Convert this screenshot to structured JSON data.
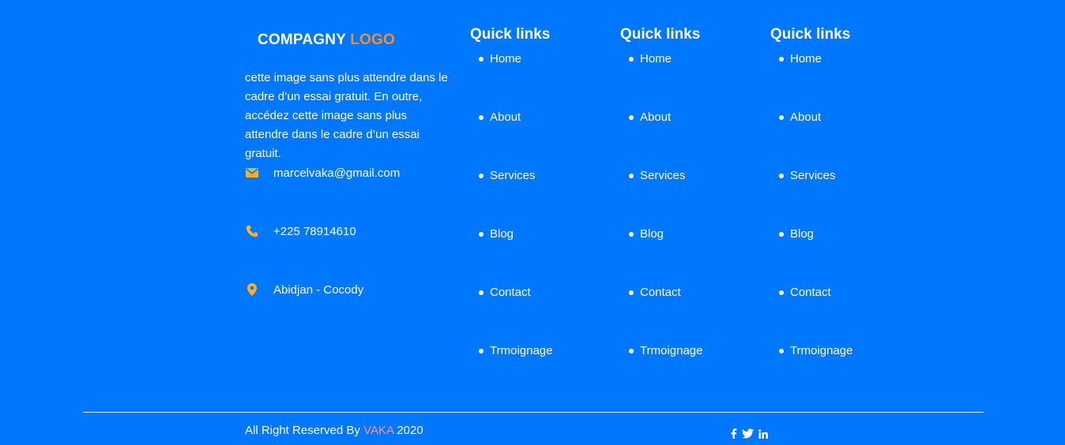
{
  "colors": {
    "background": "#0077ff",
    "accent": "#ff8a1e",
    "icon": "#ffb020",
    "vaka": "#ff8f8f"
  },
  "brand": {
    "name": "COMPAGNY",
    "logo": "LOGO"
  },
  "about_text": "cette image sans plus attendre dans le cadre d’un essai gratuit. En outre, accédez cette image sans plus attendre dans le cadre d’un essai gratuit.",
  "contacts": [
    {
      "icon": "envelope-icon",
      "text": "marcelvaka@gmail.com"
    },
    {
      "icon": "phone-icon",
      "text": "+225 78914610"
    },
    {
      "icon": "map-pin-icon",
      "text": "Abidjan - Cocody"
    }
  ],
  "columns": [
    {
      "title": "Quick links",
      "links": [
        "Home",
        "About",
        "Services",
        "Blog",
        "Contact",
        "Trmoignage"
      ]
    },
    {
      "title": "Quick links",
      "links": [
        "Home",
        "About",
        "Services",
        "Blog",
        "Contact",
        "Trmoignage"
      ]
    },
    {
      "title": "Quick links",
      "links": [
        "Home",
        "About",
        "Services",
        "Blog",
        "Contact",
        "Trmoignage"
      ]
    }
  ],
  "footer": {
    "prefix": "All Right Reserved By",
    "name": "VAKA",
    "year": "2020",
    "social": [
      "facebook-icon",
      "twitter-icon",
      "linkedin-icon"
    ]
  }
}
